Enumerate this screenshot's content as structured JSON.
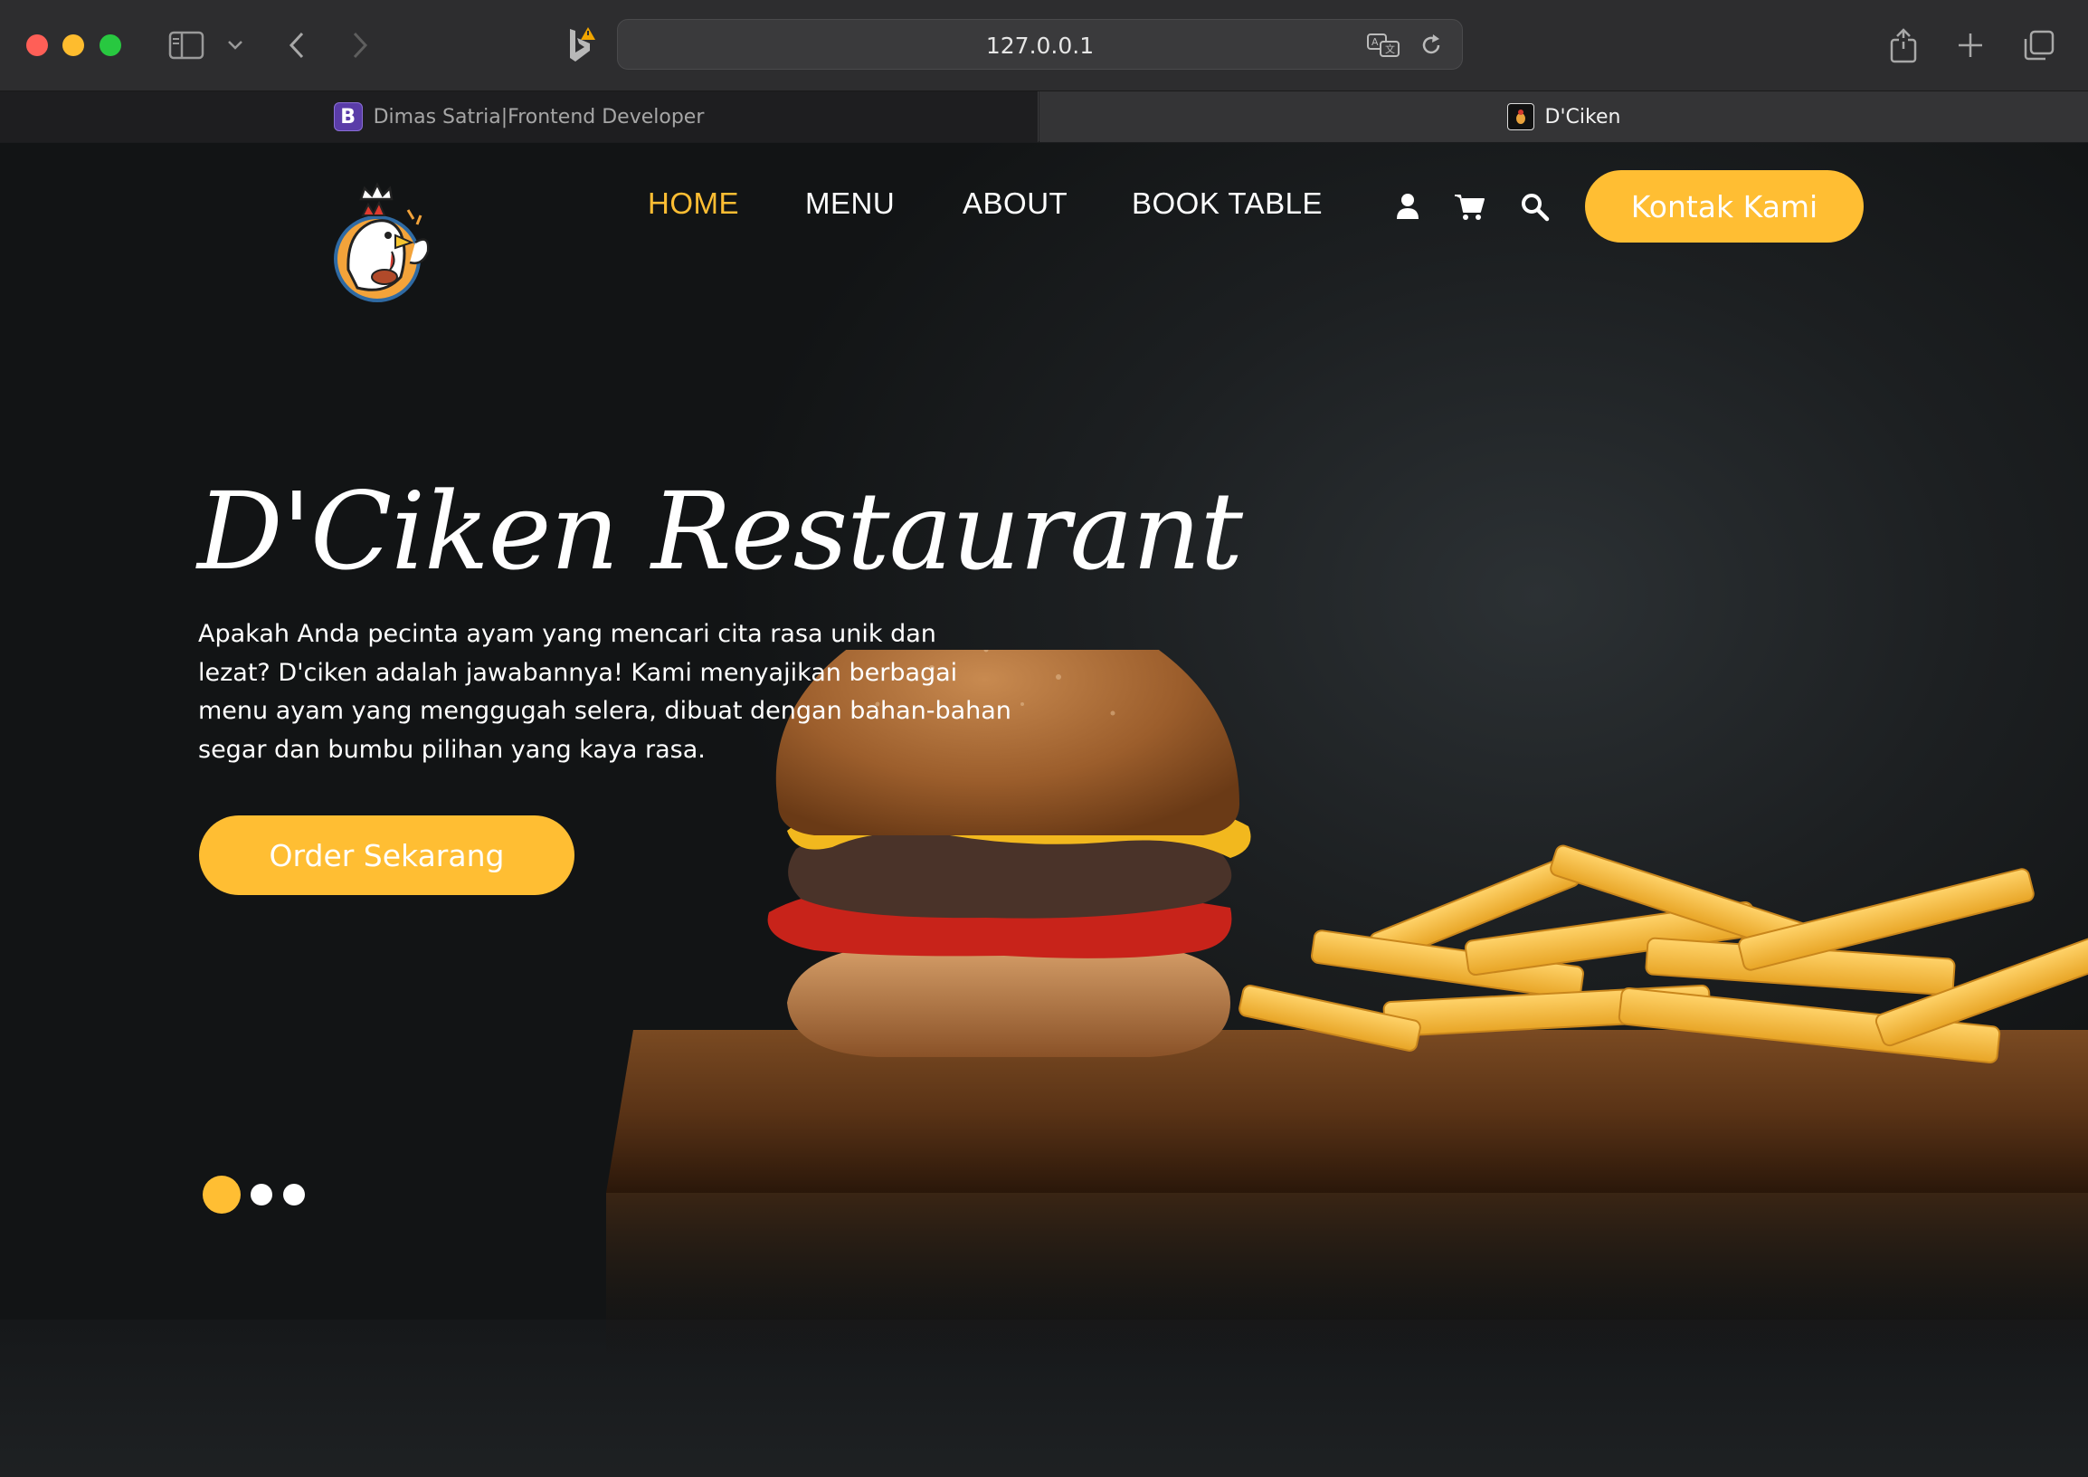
{
  "browser": {
    "url": "127.0.0.1",
    "tabs": [
      {
        "title": "Dimas Satria|Frontend Developer",
        "favicon": "B",
        "active": false
      },
      {
        "title": "D'Ciken",
        "active": true
      }
    ]
  },
  "nav": {
    "items": [
      {
        "label": "HOME",
        "active": true
      },
      {
        "label": "MENU",
        "active": false
      },
      {
        "label": "ABOUT",
        "active": false
      },
      {
        "label": "BOOK TABLE",
        "active": false
      }
    ],
    "icons": [
      "user-icon",
      "cart-icon",
      "search-icon"
    ],
    "cta": "Kontak Kami"
  },
  "hero": {
    "title": "D'Ciken Restaurant",
    "description": "Apakah Anda pecinta ayam yang mencari cita rasa unik dan lezat? D'ciken adalah jawabannya! Kami menyajikan berbagai menu ayam yang menggugah selera, dibuat dengan bahan-bahan segar dan bumbu pilihan yang kaya rasa.",
    "button": "Order Sekarang",
    "slides": 3,
    "active_slide": 1
  },
  "colors": {
    "accent": "#ffbe33",
    "background": "#1c1f21",
    "text": "#ffffff"
  }
}
